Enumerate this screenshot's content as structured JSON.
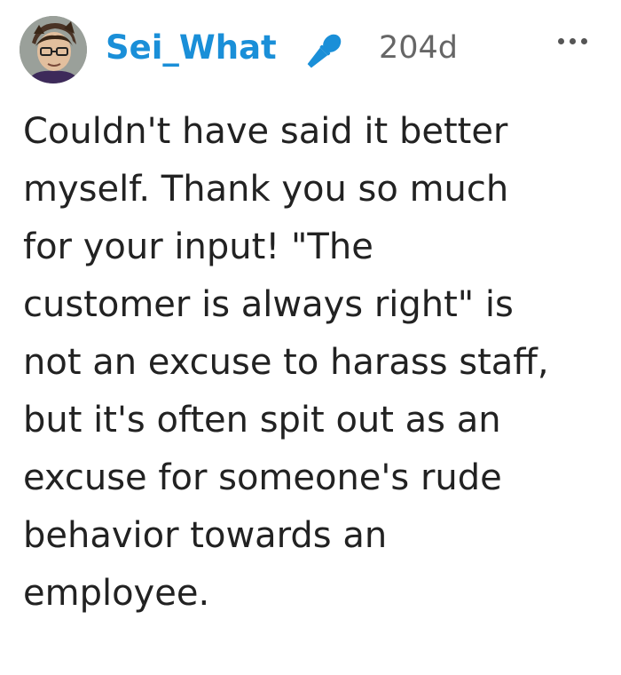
{
  "theme": {
    "accent": "#1a8fd8",
    "text": "#222222",
    "muted": "#666666"
  },
  "comment": {
    "author": {
      "username": "Sei_What",
      "avatar_icon": "avatar-image",
      "badge_icon": "microphone-icon"
    },
    "timestamp": "204d",
    "menu_icon": "more-options-icon",
    "text": "Couldn't have said it better\nmyself. Thank you so much\nfor your input! \"The\ncustomer is always right\" is\nnot an excuse to harass staff,\nbut it's often spit out as an\nexcuse for someone's rude\nbehavior towards an\nemployee."
  }
}
